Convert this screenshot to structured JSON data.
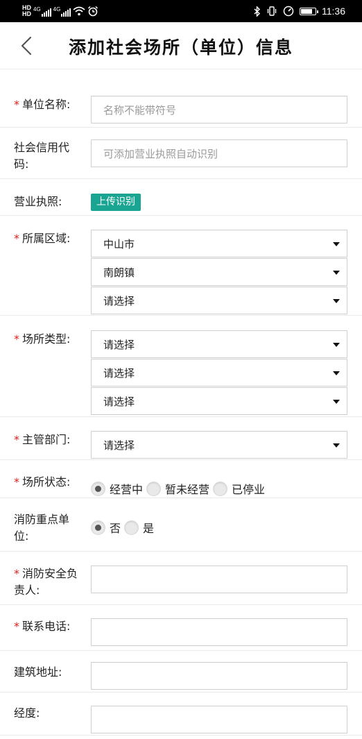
{
  "status_bar": {
    "left_icons": [
      "hd-icon",
      "hd-icon",
      "signal-4g-icon",
      "signal-4g-icon",
      "wifi-icon",
      "alarm-icon"
    ],
    "right_icons": [
      "bluetooth-icon",
      "vibrate-icon",
      "speedometer-icon",
      "battery-icon"
    ],
    "network_label": "4G",
    "hd_label": "HD",
    "time": "11:36"
  },
  "header": {
    "title": "添加社会场所（单位）信息",
    "back_icon": "chevron-left-icon"
  },
  "form": {
    "unit_name": {
      "required_mark": "*",
      "label": "单位名称:",
      "placeholder": "名称不能带符号",
      "value": ""
    },
    "credit_code": {
      "label": "社会信用代码:",
      "placeholder": "可添加营业执照自动识别",
      "value": ""
    },
    "license": {
      "label": "营业执照:",
      "button": "上传识别",
      "button_color": "#1aa592"
    },
    "region": {
      "required_mark": "*",
      "label": "所属区域:",
      "selects": [
        "中山市",
        "南朗镇",
        "请选择"
      ]
    },
    "venue_type": {
      "required_mark": "*",
      "label": "场所类型:",
      "selects": [
        "请选择",
        "请选择",
        "请选择"
      ]
    },
    "department": {
      "required_mark": "*",
      "label": "主管部门:",
      "selects": [
        "请选择"
      ]
    },
    "venue_status": {
      "required_mark": "*",
      "label": "场所状态:",
      "options": [
        "经营中",
        "暂未经营",
        "已停业"
      ],
      "selected": "经营中"
    },
    "fire_key_unit": {
      "label": "消防重点单位:",
      "options": [
        "否",
        "是"
      ],
      "selected": "否"
    },
    "fire_safety_person": {
      "required_mark": "*",
      "label": "消防安全负责人:",
      "value": ""
    },
    "phone": {
      "required_mark": "*",
      "label": "联系电话:",
      "value": ""
    },
    "address": {
      "label": "建筑地址:",
      "value": ""
    },
    "longitude": {
      "label": "经度:",
      "value": ""
    }
  },
  "colors": {
    "required": "#d9211d",
    "accent": "#1aa592",
    "border": "#cfcfcf"
  }
}
